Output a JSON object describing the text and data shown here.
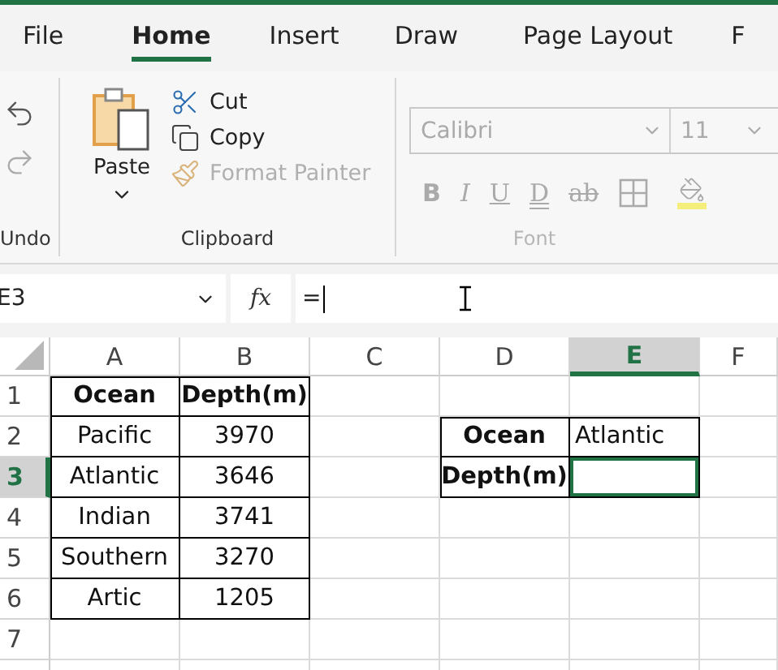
{
  "tabs": [
    {
      "label": "File",
      "selected": false
    },
    {
      "label": "Home",
      "selected": true
    },
    {
      "label": "Insert",
      "selected": false
    },
    {
      "label": "Draw",
      "selected": false
    },
    {
      "label": "Page Layout",
      "selected": false
    },
    {
      "label": "F",
      "selected": false
    }
  ],
  "ribbon": {
    "undo": {
      "label": "Undo"
    },
    "clipboard": {
      "label": "Clipboard",
      "paste": "Paste",
      "cut": "Cut",
      "copy": "Copy",
      "format_painter": {
        "label": "Format Painter",
        "disabled": true
      }
    },
    "font": {
      "label": "Font",
      "disabled": true,
      "font_name": "Calibri",
      "font_size": "11",
      "styles": [
        {
          "label": "B",
          "kind": "bold"
        },
        {
          "label": "I",
          "kind": "italic"
        },
        {
          "label": "U",
          "kind": "underline"
        },
        {
          "label": "D",
          "kind": "double"
        },
        {
          "label": "ab",
          "kind": "strike"
        }
      ]
    }
  },
  "name_box": "E3",
  "function_button": "fx",
  "formula": "=",
  "sheet": {
    "columns": [
      {
        "label": "A",
        "selected": false
      },
      {
        "label": "B",
        "selected": false
      },
      {
        "label": "C",
        "selected": false
      },
      {
        "label": "D",
        "selected": false
      },
      {
        "label": "E",
        "selected": true
      },
      {
        "label": "F",
        "selected": false
      }
    ],
    "rows": [
      {
        "label": "1",
        "selected": false,
        "cells": [
          {
            "text": "Ocean",
            "bold": true,
            "bordered": true
          },
          {
            "text": "Depth(m)",
            "bold": true,
            "bordered": true
          },
          {
            "bordered": false
          },
          {
            "bordered": false
          },
          {
            "bordered": false
          },
          {
            "bordered": false
          }
        ]
      },
      {
        "label": "2",
        "selected": false,
        "cells": [
          {
            "text": "Pacific",
            "bold": false,
            "bordered": true
          },
          {
            "text": "3970",
            "bold": false,
            "bordered": true
          },
          {
            "bordered": false
          },
          {
            "text": "Ocean",
            "bold": true,
            "bordered": true
          },
          {
            "text": "Atlantic",
            "bold": false,
            "bordered": true
          },
          {
            "bordered": false
          }
        ]
      },
      {
        "label": "3",
        "selected": true,
        "cells": [
          {
            "text": "Atlantic",
            "bold": false,
            "bordered": true
          },
          {
            "text": "3646",
            "bold": false,
            "bordered": true
          },
          {
            "bordered": false
          },
          {
            "text": "Depth(m)",
            "bold": true,
            "bordered": true
          },
          {
            "bordered": true
          },
          {
            "bordered": false
          }
        ]
      },
      {
        "label": "4",
        "selected": false,
        "cells": [
          {
            "text": "Indian",
            "bold": false,
            "bordered": true
          },
          {
            "text": "3741",
            "bold": false,
            "bordered": true
          },
          {
            "bordered": false
          },
          {
            "bordered": false
          },
          {
            "bordered": false
          },
          {
            "bordered": false
          }
        ]
      },
      {
        "label": "5",
        "selected": false,
        "cells": [
          {
            "text": "Southern",
            "bold": false,
            "bordered": true
          },
          {
            "text": "3270",
            "bold": false,
            "bordered": true
          },
          {
            "bordered": false
          },
          {
            "bordered": false
          },
          {
            "bordered": false
          },
          {
            "bordered": false
          }
        ]
      },
      {
        "label": "6",
        "selected": false,
        "cells": [
          {
            "text": "Artic",
            "bold": false,
            "bordered": true
          },
          {
            "text": "1205",
            "bold": false,
            "bordered": true
          },
          {
            "bordered": false
          },
          {
            "bordered": false
          },
          {
            "bordered": false
          },
          {
            "bordered": false
          }
        ]
      },
      {
        "label": "7",
        "selected": false,
        "cells": [
          {
            "bordered": false
          },
          {
            "bordered": false
          },
          {
            "bordered": false
          },
          {
            "bordered": false
          },
          {
            "bordered": false
          },
          {
            "bordered": false
          }
        ]
      }
    ]
  }
}
